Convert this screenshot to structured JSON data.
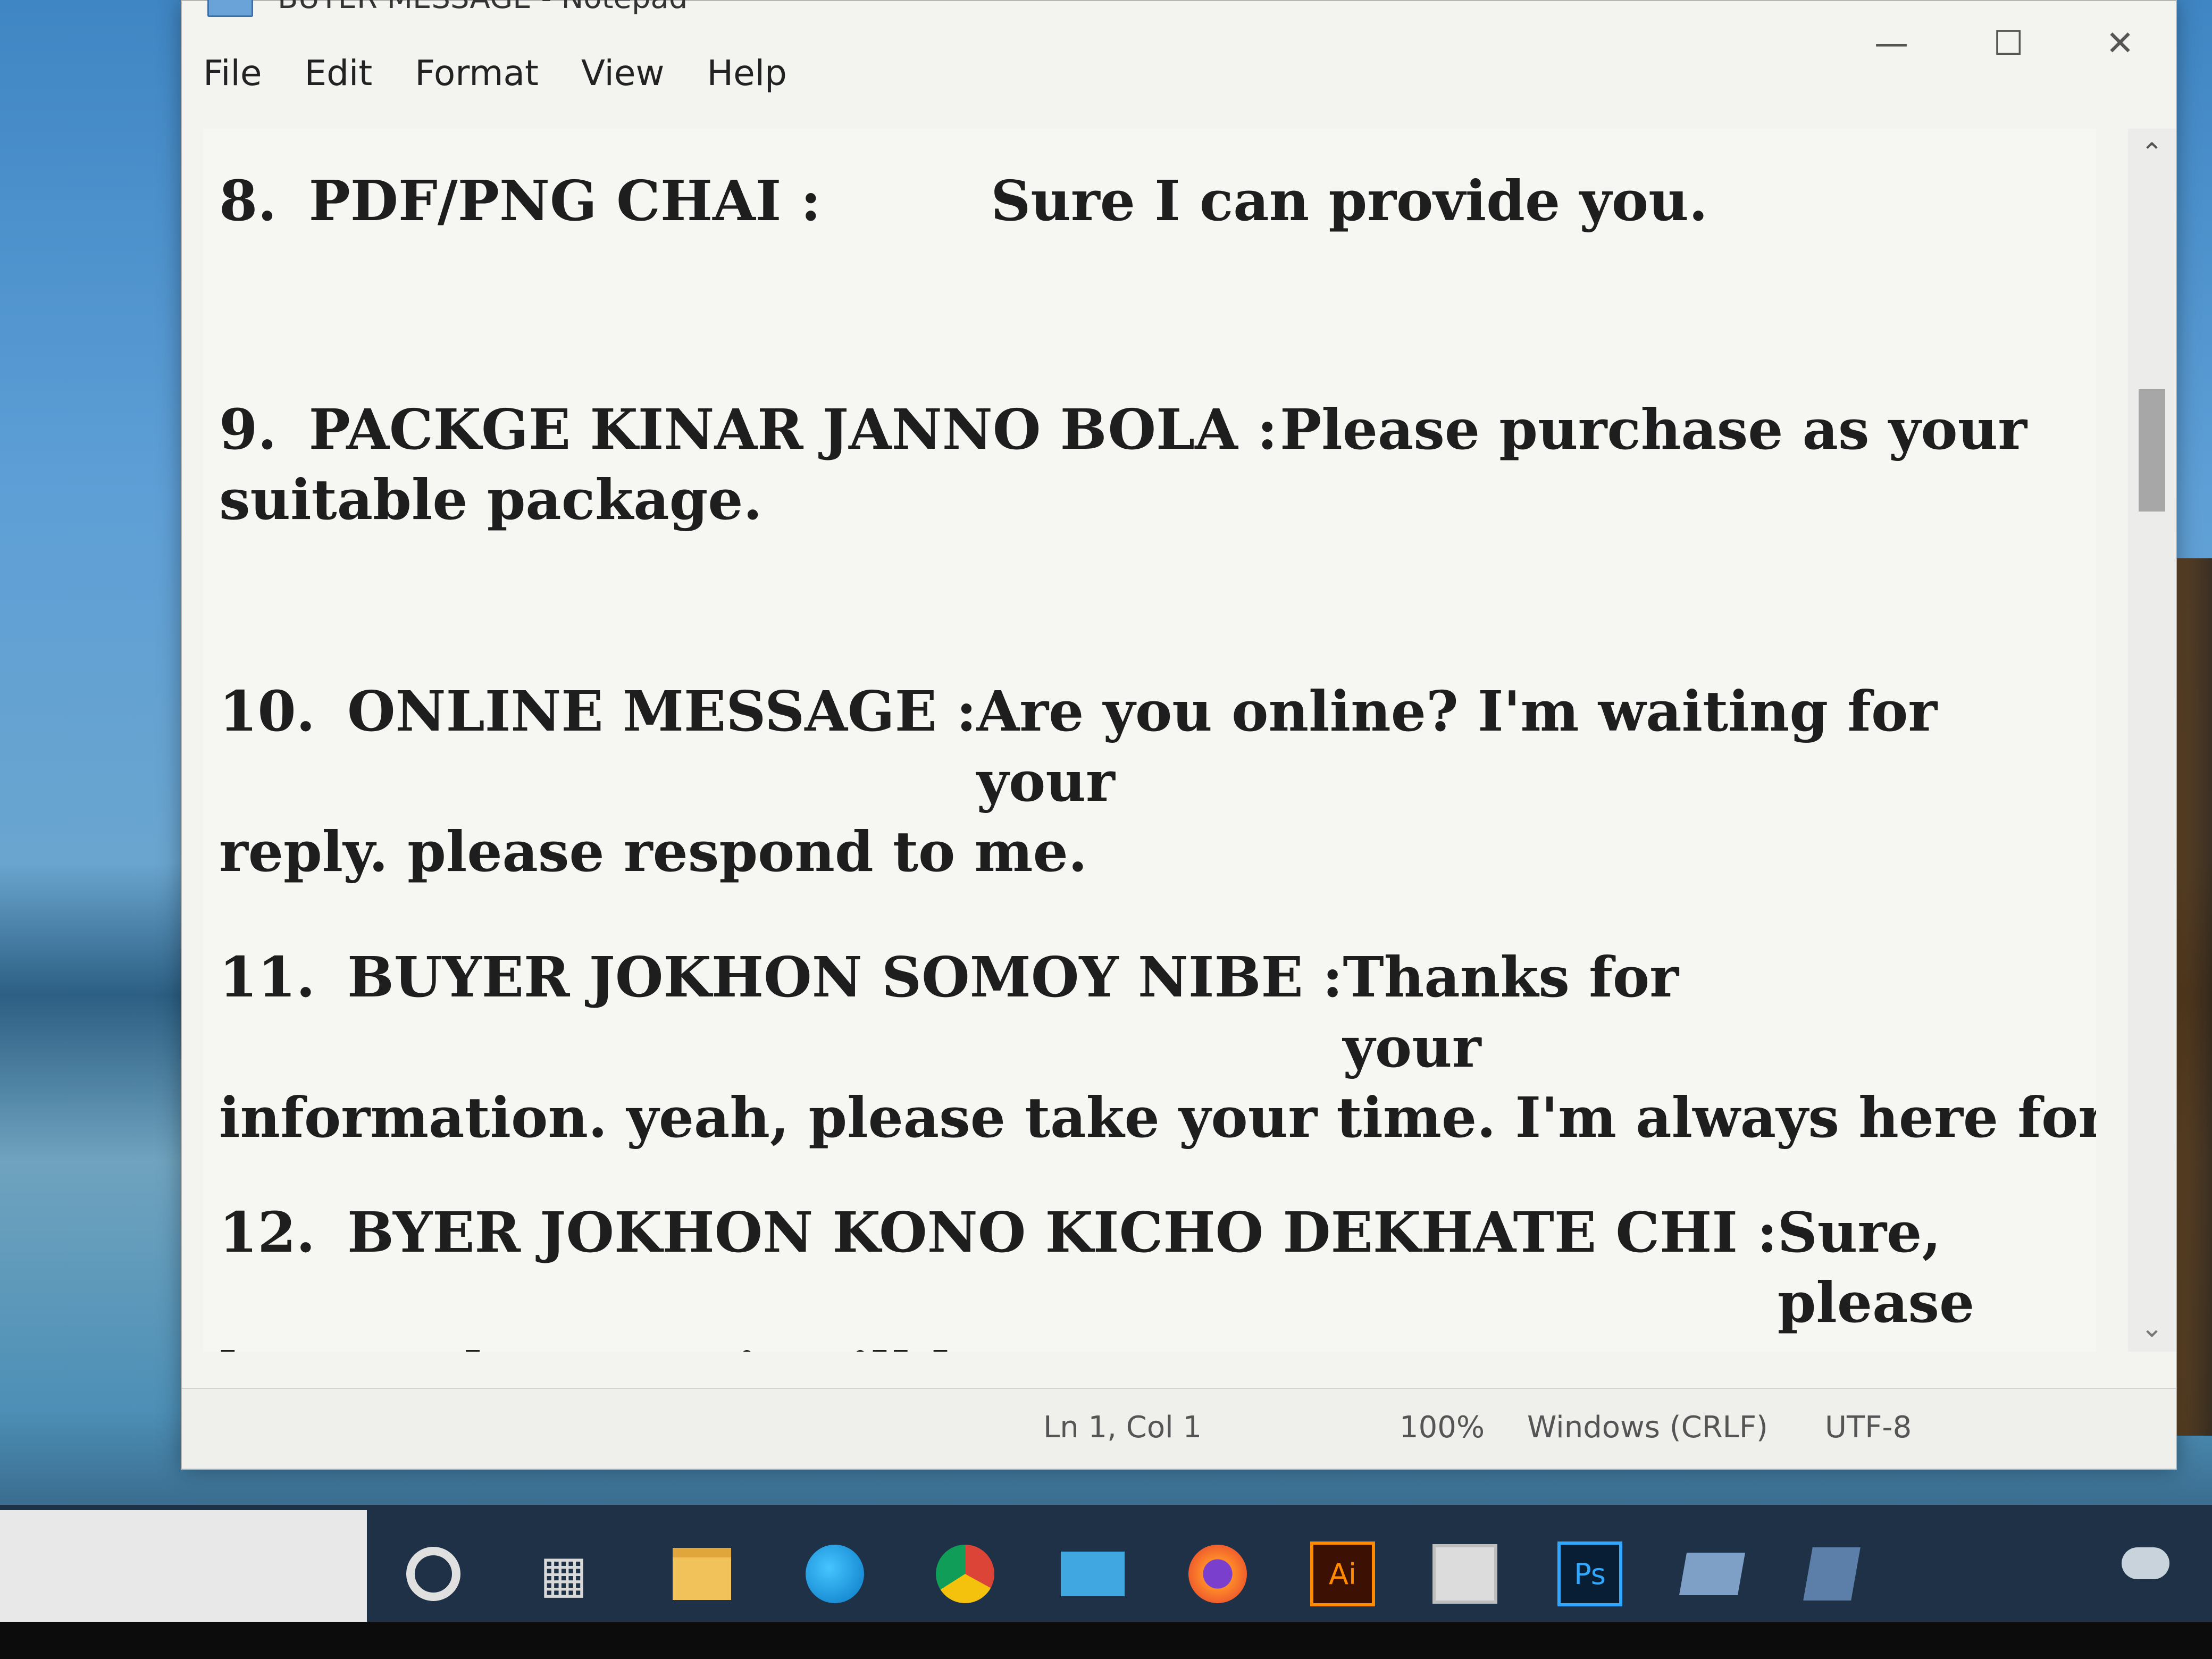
{
  "window": {
    "title": "BUYER MESSAGE - Notepad",
    "minimize_icon": "minimize-icon",
    "maximize_icon": "maximize-icon",
    "close_icon": "close-icon"
  },
  "menu": {
    "file": "File",
    "edit": "Edit",
    "format": "Format",
    "view": "View",
    "help": "Help"
  },
  "entries": [
    {
      "num": "8.",
      "label": "PDF/PNG CHAI :",
      "reply_line1": "Sure I can provide you.",
      "reply_line2": ""
    },
    {
      "num": "9.",
      "label": "PACKGE KINAR JANNO BOLA :",
      "reply_line1": "Please purchase as your",
      "reply_line2": "suitable package."
    },
    {
      "num": "10.",
      "label": "ONLINE MESSAGE :",
      "reply_line1": "Are you online? I'm waiting for your",
      "reply_line2": "reply. please respond to me."
    },
    {
      "num": "11.",
      "label": "BUYER JOKHON SOMOY NIBE :",
      "reply_line1": "Thanks for your",
      "reply_line2": "information. yeah, please take your time. I'm always here for you."
    },
    {
      "num": "12.",
      "label": "BYER JOKHON KONO KICHO DEKHATE CHI :",
      "reply_line1": "Sure, please",
      "reply_line2": "let me show you it will be great!"
    }
  ],
  "status": {
    "position": "Ln 1, Col 1",
    "zoom": "100%",
    "line_ending": "Windows (CRLF)",
    "encoding": "UTF-8"
  },
  "taskbar": {
    "icons": [
      "cortana-icon",
      "task-view-icon",
      "file-explorer-icon",
      "edge-icon",
      "chrome-icon",
      "mail-icon",
      "firefox-icon",
      "illustrator-icon",
      "store-icon",
      "photoshop-icon",
      "app-icon",
      "app-icon"
    ],
    "ai_label": "Ai",
    "ps_label": "Ps"
  }
}
